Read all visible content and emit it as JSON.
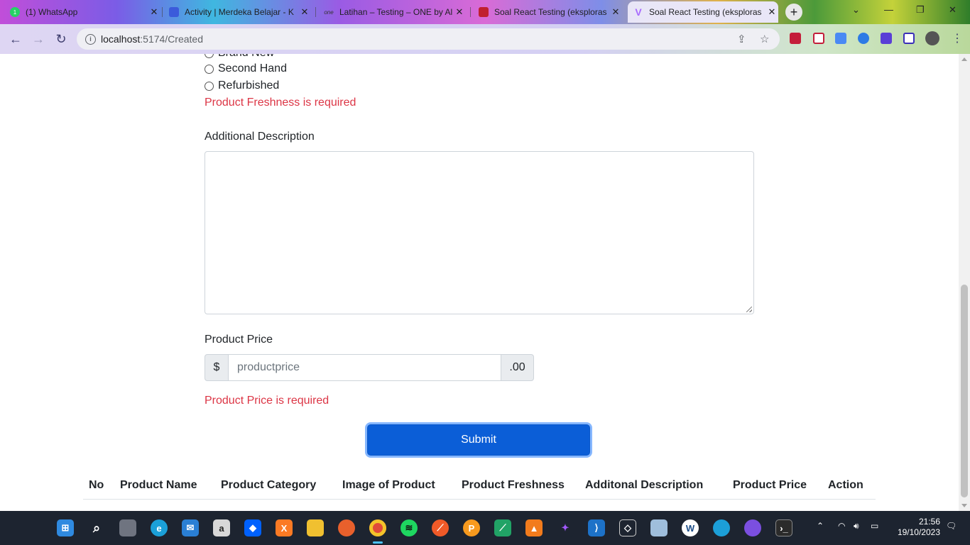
{
  "browser": {
    "tabs": [
      {
        "title": "(1) WhatsApp",
        "favicon": "whatsapp-icon",
        "color": "#25d366"
      },
      {
        "title": "Activity | Merdeka Belajar - K",
        "favicon": "kampus-merdeka-icon",
        "color": "#3b5bdb"
      },
      {
        "title": "Latihan – Testing – ONE by Al",
        "favicon": "one-icon",
        "color": "#333333"
      },
      {
        "title": "Soal React Testing (eksploras",
        "favicon": "book-icon",
        "color": "#c0202f"
      },
      {
        "title": "Soal React Testing (eksploras",
        "favicon": "vite-icon",
        "color": "#a86bff"
      }
    ],
    "new_tab_label": "+",
    "url_host": "localhost",
    "url_rest": ":5174/Created"
  },
  "form": {
    "radio_partial_label": "Brand New",
    "radio_options": [
      "Second Hand",
      "Refurbished"
    ],
    "freshness_error": "Product Freshness is required",
    "description_label": "Additional Description",
    "price_label": "Product Price",
    "price_prefix": "$",
    "price_placeholder": "productprice",
    "price_suffix": ".00",
    "price_error": "Product Price is required",
    "submit_label": "Submit"
  },
  "table": {
    "headers": [
      "No",
      "Product Name",
      "Product Category",
      "Image of Product",
      "Product Freshness",
      "Additonal Description",
      "Product Price",
      "Action"
    ]
  },
  "taskbar": {
    "time": "21:56",
    "date": "19/10/2023"
  },
  "colors": {
    "primary": "#0b5ed7",
    "error": "#dc3545"
  }
}
